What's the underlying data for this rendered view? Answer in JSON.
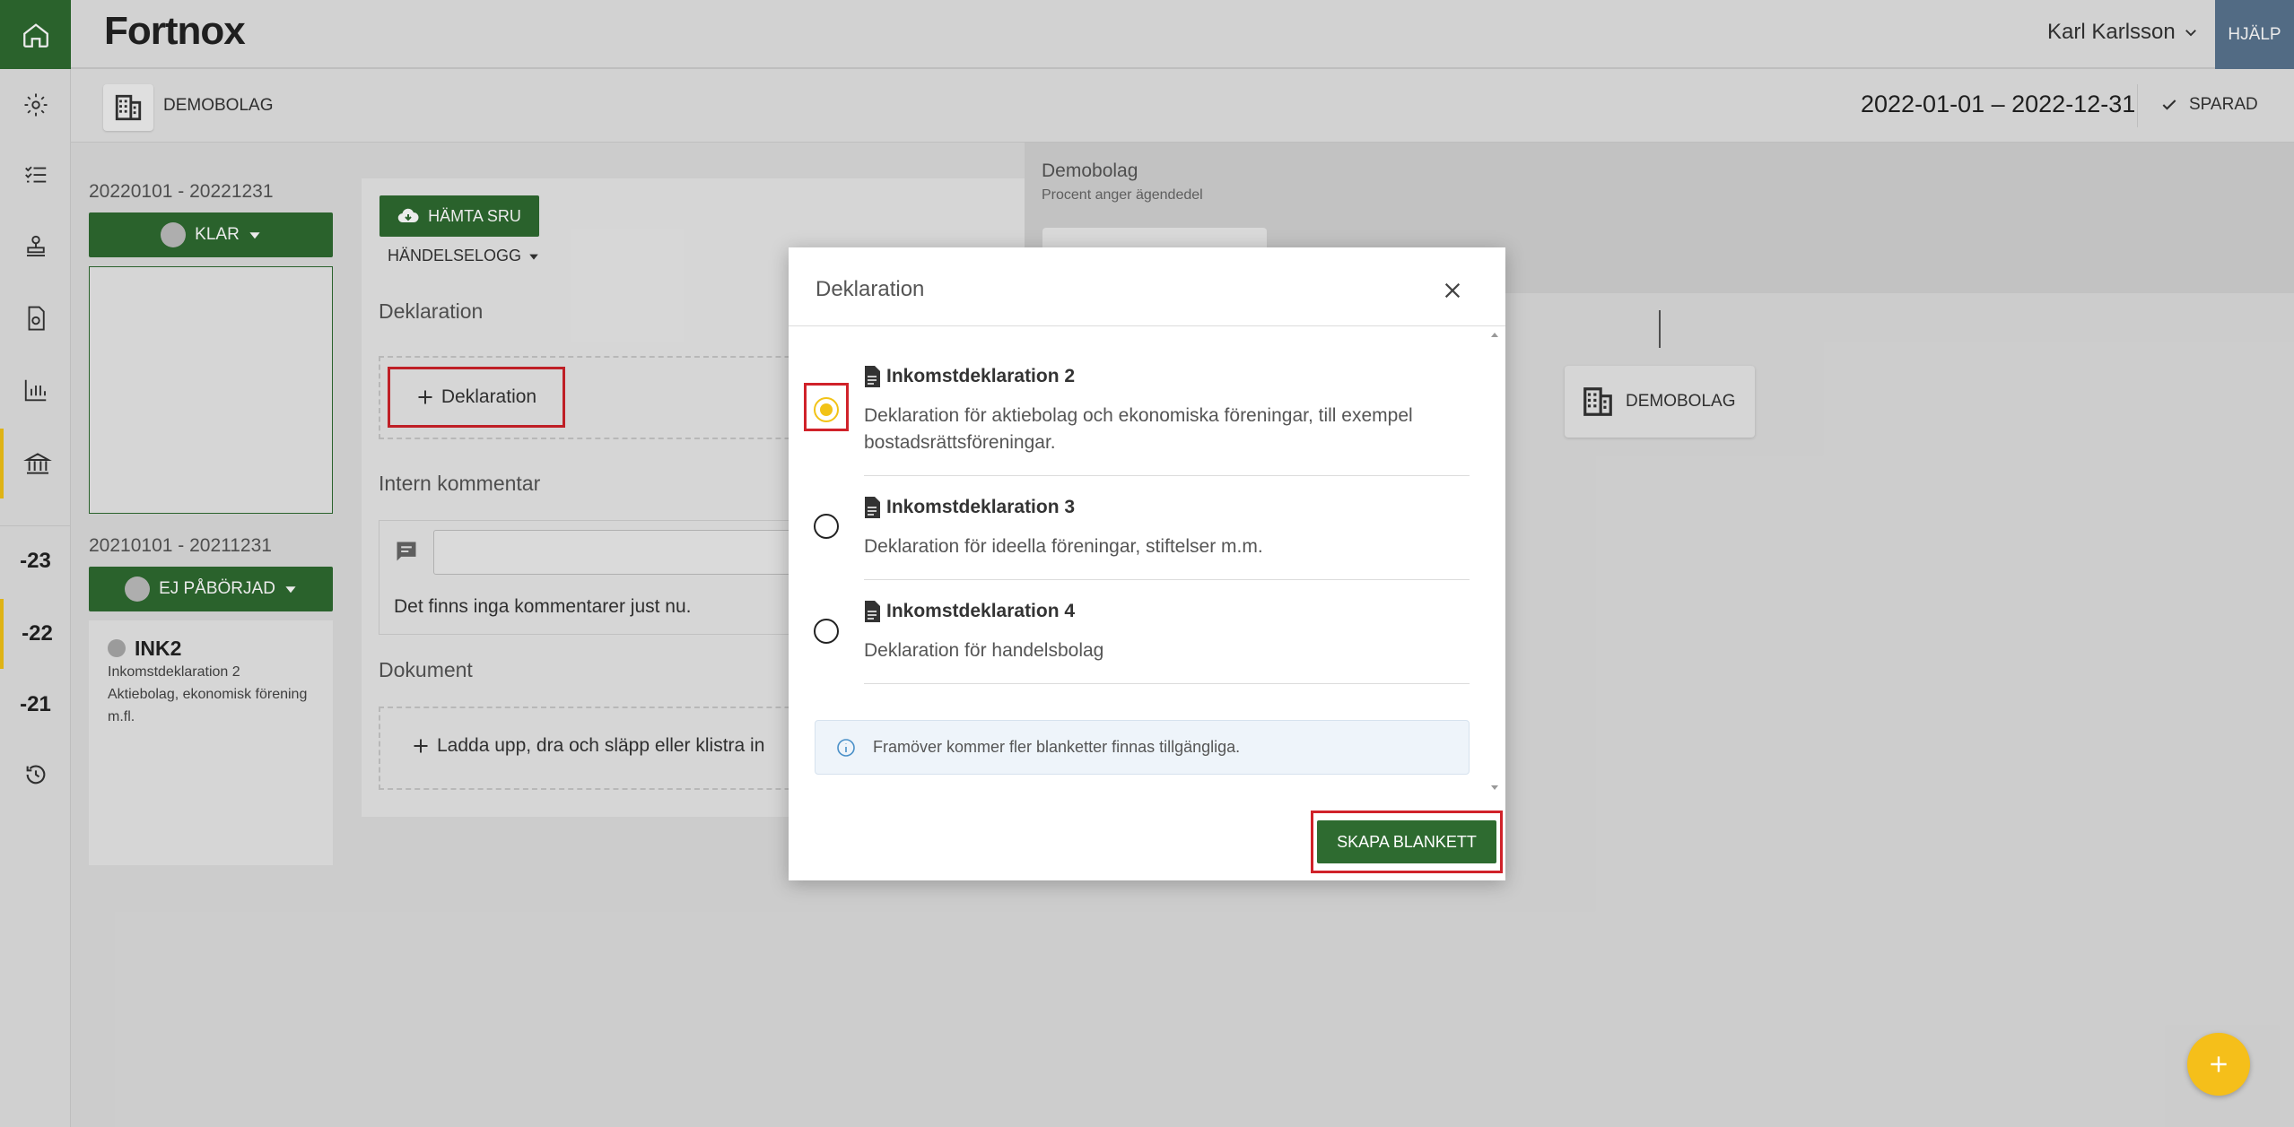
{
  "app": {
    "logo": "Fortnox",
    "user": "Karl Karlsson",
    "help": "HJÄLP"
  },
  "subbar": {
    "company": "DEMOBOLAG",
    "period": "2022-01-01 – 2022-12-31",
    "saved": "SPARAD"
  },
  "rail": {
    "years": [
      "-23",
      "-22",
      "-21"
    ]
  },
  "left": {
    "year1": {
      "range": "20220101 - 20221231",
      "status": "KLAR"
    },
    "year2": {
      "range": "20210101 - 20211231",
      "status": "EJ PÅBÖRJAD"
    },
    "ink": {
      "title": "INK2",
      "desc": "Inkomstdeklaration 2 Aktiebolag, ekonomisk förening m.fl."
    }
  },
  "mid": {
    "hamta": "HÄMTA SRU",
    "handelse": "HÄNDELSELOGG",
    "dekl_heading": "Deklaration",
    "dekl_button": "Deklaration",
    "comment_heading": "Intern kommentar",
    "no_comments": "Det finns inga kommentarer just nu.",
    "doc_heading": "Dokument",
    "upload": "Ladda upp, dra och släpp eller klistra in"
  },
  "right": {
    "title": "Demobolag",
    "subtitle": "Procent anger ägendedel",
    "card": "DEMOBOLAG"
  },
  "modal": {
    "title": "Deklaration",
    "options": [
      {
        "title": "Inkomstdeklaration 2",
        "desc": "Deklaration för aktiebolag och ekonomiska föreningar, till exempel bostadsrättsföreningar.",
        "selected": true
      },
      {
        "title": "Inkomstdeklaration 3",
        "desc": "Deklaration för ideella föreningar, stiftelser m.m.",
        "selected": false
      },
      {
        "title": "Inkomstdeklaration 4",
        "desc": "Deklaration för handelsbolag",
        "selected": false
      }
    ],
    "info": "Framöver kommer fler blanketter finnas tillgängliga.",
    "create_button": "SKAPA BLANKETT"
  },
  "colors": {
    "brand_green": "#2e6b30",
    "accent_yellow": "#f2c317",
    "highlight_red": "#d0222a",
    "help_blue": "#5a7590"
  }
}
